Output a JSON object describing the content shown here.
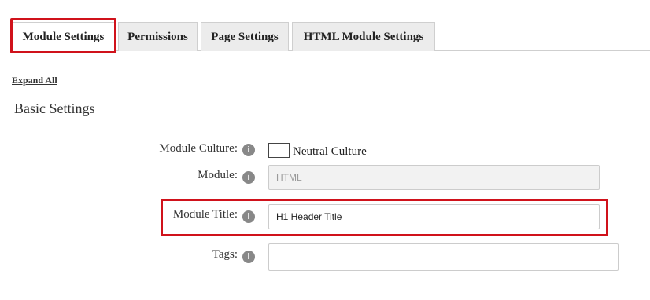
{
  "tabs": [
    {
      "label": "Module Settings",
      "active": true
    },
    {
      "label": "Permissions",
      "active": false
    },
    {
      "label": "Page Settings",
      "active": false
    },
    {
      "label": "HTML Module Settings",
      "active": false
    }
  ],
  "expand_all": "Expand All",
  "section": {
    "title": "Basic Settings"
  },
  "fields": {
    "module_culture": {
      "label": "Module Culture:",
      "checkbox_label": "Neutral Culture",
      "checked": false
    },
    "module": {
      "label": "Module:",
      "value": "HTML"
    },
    "module_title": {
      "label": "Module Title:",
      "value": "H1 Header Title"
    },
    "tags": {
      "label": "Tags:",
      "value": ""
    }
  },
  "icons": {
    "info": "info-icon"
  },
  "colors": {
    "highlight": "#d0121b",
    "tab_bg": "#ececec",
    "info_icon": "#888888"
  }
}
